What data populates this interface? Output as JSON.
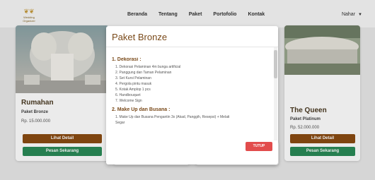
{
  "navbar": {
    "brand": "Wedding Organizer",
    "links": [
      "Beranda",
      "Tentang",
      "Paket",
      "Portofolio",
      "Kontak"
    ],
    "user": "Nahar"
  },
  "cards": [
    {
      "title": "Rumahan",
      "package": "Paket Bronze",
      "price": "Rp. 15.000.000",
      "detail_label": "Lihat Detail",
      "order_label": "Pesan Sekarang"
    },
    {
      "title": "The Queen",
      "package": "Paket Platinum",
      "price": "Rp. 52.000.000",
      "detail_label": "Lihat Detail",
      "order_label": "Pesan Sekarang"
    }
  ],
  "modal": {
    "title": "Paket Bronze",
    "sections": [
      {
        "title": "1. Dekorasi :",
        "items": [
          "1. Dekorasi Pelaminan 4m bunga artificial",
          "2. Panggung dan Taman Pelaminan",
          "3. Set Kursi Pelaminan",
          "4. Pergola pintu masuk",
          "5. Kotak Amplop 1 pcs",
          "6. Handbouquet",
          "7. Welcome Sign"
        ]
      },
      {
        "title": "2. Make Up dan Busana :",
        "items": [
          "1. Make Up dan Busana Pengantin 3x (Akad, Panggih, Resepsi) + Melati",
          "Segar"
        ]
      }
    ],
    "close_label": "TUTUP"
  },
  "colors": {
    "brown": "#8a4b12",
    "green": "#2a8a57",
    "red": "#e24c4c"
  }
}
